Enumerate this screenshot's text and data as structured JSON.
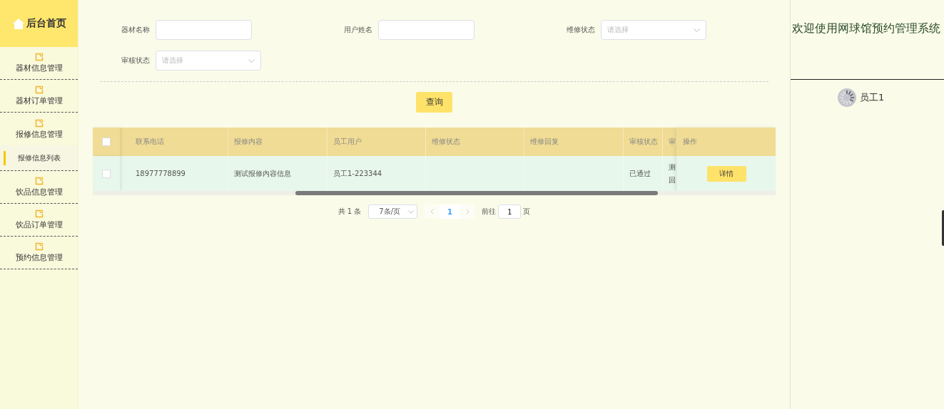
{
  "sidebar": {
    "home": "后台首页",
    "items": [
      {
        "label": "器材信息管理"
      },
      {
        "label": "器材订单管理"
      },
      {
        "label": "报修信息管理",
        "children": [
          {
            "label": "报修信息列表",
            "selected": true
          }
        ]
      },
      {
        "label": "饮品信息管理"
      },
      {
        "label": "饮品订单管理"
      },
      {
        "label": "预约信息管理"
      }
    ]
  },
  "filters": [
    {
      "label": "器材名称",
      "kind": "input"
    },
    {
      "label": "用户姓名",
      "kind": "input"
    },
    {
      "label": "维修状态",
      "kind": "select",
      "placeholder": "请选择"
    },
    {
      "label": "审核状态",
      "kind": "select",
      "placeholder": "请选择"
    }
  ],
  "search_button": "查询",
  "table": {
    "select_all": {
      "checked": false
    },
    "columns": [
      "联系电话",
      "报修内容",
      "员工用户",
      "维修状态",
      "维修回复",
      "审核状态",
      "审"
    ],
    "action_column": "操作",
    "rows": [
      {
        "checked": false,
        "cells": [
          "18977778899",
          "测试报修内容信息",
          "员工1-223344",
          null,
          null,
          "已通过",
          [
            "测",
            "回"
          ]
        ],
        "action": "详情"
      }
    ]
  },
  "pagination": {
    "total": "共 1 条",
    "page_size": "7条/页",
    "pages": [
      {
        "label": "1",
        "selected": true
      }
    ],
    "goto_label": "前往",
    "goto_value": "1",
    "goto_suffix": "页"
  },
  "header": {
    "welcome": "欢迎使用网球馆预约管理系统",
    "user": "员工1"
  }
}
